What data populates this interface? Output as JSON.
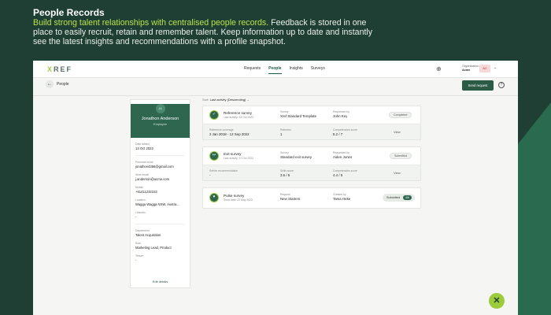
{
  "hero": {
    "title": "People Records",
    "desc_highlight": "Build strong talent relationships with centralised people records.",
    "desc_rest": " Feedback is stored in one place to easily recruit, retain and remember talent. Keep information up to date and instantly see the latest insights and recommendations with a profile snapshot."
  },
  "app": {
    "logo_accent": "X",
    "logo_rest": "REF",
    "nav": [
      "Requests",
      "People",
      "Insights",
      "Surveys"
    ],
    "nav_active_index": 1,
    "org_label": "Organisation",
    "org_name": "Acme",
    "org_badge": "AC",
    "page_label": "People",
    "send_request": "Send request"
  },
  "profile": {
    "initials": "JA",
    "name": "Jonathon Anderson",
    "role": "Employee",
    "fields_top": [
      {
        "label": "Date added",
        "value": "13 Oct 2022"
      }
    ],
    "fields_mid": [
      {
        "label": "Personal email",
        "value": "jonathon4356@gmail.com"
      },
      {
        "label": "Work email",
        "value": "j.anderson@acme.com"
      },
      {
        "label": "Mobile",
        "value": "+61411232223"
      },
      {
        "label": "Location",
        "value": "Wagga Wagga NSW, Austra..."
      },
      {
        "label": "LinkedIn",
        "value": "-"
      }
    ],
    "fields_bottom": [
      {
        "label": "Department",
        "value": "Talent Acquisition"
      },
      {
        "label": "Role",
        "value": "Marketing Lead, Product"
      },
      {
        "label": "Tenure",
        "value": "-"
      }
    ],
    "edit_label": "Edit details"
  },
  "sort": {
    "label": "Sort:",
    "value": "Last activity (Descending)"
  },
  "surveys": [
    {
      "title": "Reference survey",
      "sub": "Last activity: 18 Oct 2022",
      "col1_label": "Survey",
      "col1_value": "Xref Standard Template",
      "col2_label": "Requested by",
      "col2_value": "John Key",
      "status": "Completed",
      "b1_label": "Reference coverage",
      "b1_value": "2 Jan 2018 - 12 Sep 2022",
      "b2_label": "Referees",
      "b2_value": "1",
      "b3_label": "Competencies score",
      "b3_value": "5.2 / 7",
      "view": "View"
    },
    {
      "title": "Exit survey",
      "sub": "Last activity: 17 Oct 2022",
      "col1_label": "Survey",
      "col1_value": "Standard exit survey",
      "col2_label": "Requested by",
      "col2_value": "Aiden Jones",
      "status": "Submitted",
      "b1_label": "Rehire recommendation",
      "b1_value": "-",
      "b2_label": "Skills score",
      "b2_value": "3.6 / 5",
      "b3_label": "Competencies score",
      "b3_value": "4.4 / 5",
      "view": "View"
    },
    {
      "title": "Pulse survey",
      "sub": "Send date: 22 May 2023",
      "col1_label": "Request",
      "col1_value": "New Starters",
      "col2_label": "Created by",
      "col2_value": "Tama Heke",
      "status": "Submitted",
      "status_count": "4/6"
    }
  ],
  "colors": {
    "background": "#1f3f34",
    "accent_green": "#9ccc3c",
    "primary": "#2e6650"
  }
}
